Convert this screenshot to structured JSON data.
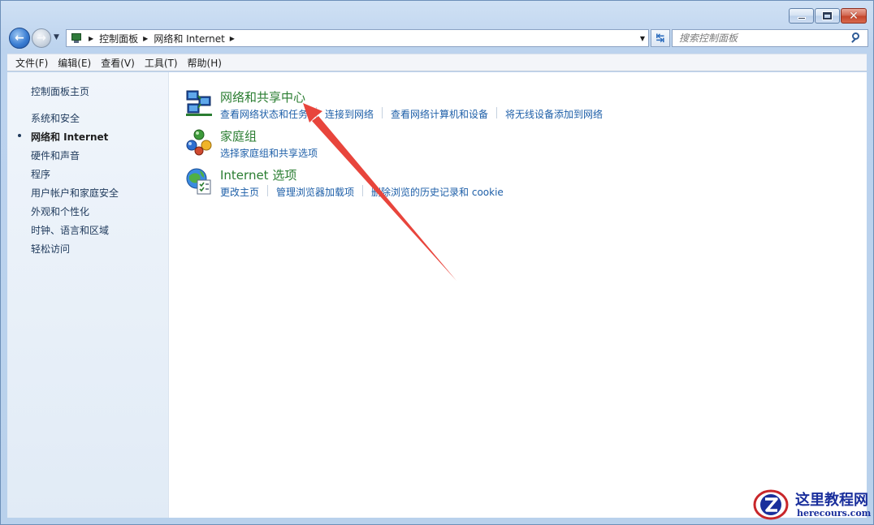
{
  "window": {
    "controls": {
      "minimize": "minimize",
      "maximize": "maximize",
      "close": "close"
    }
  },
  "nav": {
    "breadcrumbs": [
      "控制面板",
      "网络和 Internet"
    ],
    "search_placeholder": "搜索控制面板"
  },
  "menubar": {
    "items": [
      "文件(F)",
      "编辑(E)",
      "查看(V)",
      "工具(T)",
      "帮助(H)"
    ]
  },
  "sidebar": {
    "home": "控制面板主页",
    "items": [
      {
        "label": "系统和安全",
        "current": false
      },
      {
        "label": "网络和 Internet",
        "current": true
      },
      {
        "label": "硬件和声音",
        "current": false
      },
      {
        "label": "程序",
        "current": false
      },
      {
        "label": "用户帐户和家庭安全",
        "current": false
      },
      {
        "label": "外观和个性化",
        "current": false
      },
      {
        "label": "时钟、语言和区域",
        "current": false
      },
      {
        "label": "轻松访问",
        "current": false
      }
    ]
  },
  "categories": [
    {
      "title": "网络和共享中心",
      "icon": "network-sharing-center-icon",
      "links": [
        "查看网络状态和任务",
        "连接到网络",
        "查看网络计算机和设备",
        "将无线设备添加到网络"
      ]
    },
    {
      "title": "家庭组",
      "icon": "homegroup-icon",
      "links": [
        "选择家庭组和共享选项"
      ]
    },
    {
      "title": "Internet 选项",
      "icon": "internet-options-icon",
      "links": [
        "更改主页",
        "管理浏览器加载项",
        "删除浏览的历史记录和 cookie"
      ]
    }
  ],
  "watermark": {
    "title": "这里教程网",
    "subtitle": "herecours.com"
  },
  "colors": {
    "link": "#1e5fa8",
    "category_title": "#2a7d31",
    "annotation_arrow": "#e8453c"
  }
}
